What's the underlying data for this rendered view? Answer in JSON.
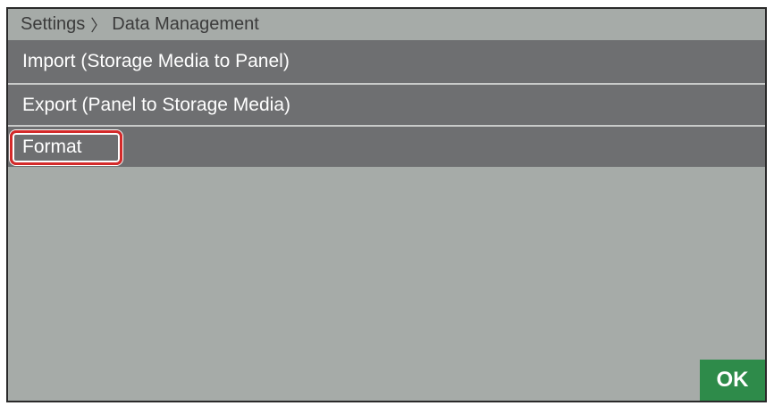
{
  "breadcrumb": {
    "parent": "Settings",
    "separator": "〉",
    "current": "Data Management"
  },
  "menu": {
    "items": [
      {
        "label": "Import (Storage Media to Panel)"
      },
      {
        "label": "Export (Panel to Storage Media)"
      },
      {
        "label": "Format",
        "highlighted": true
      }
    ]
  },
  "footer": {
    "ok_label": "OK"
  },
  "colors": {
    "background": "#a6aba8",
    "menu_item": "#6e6f71",
    "highlight": "#d42a2a",
    "ok_button": "#2e8b4a"
  }
}
